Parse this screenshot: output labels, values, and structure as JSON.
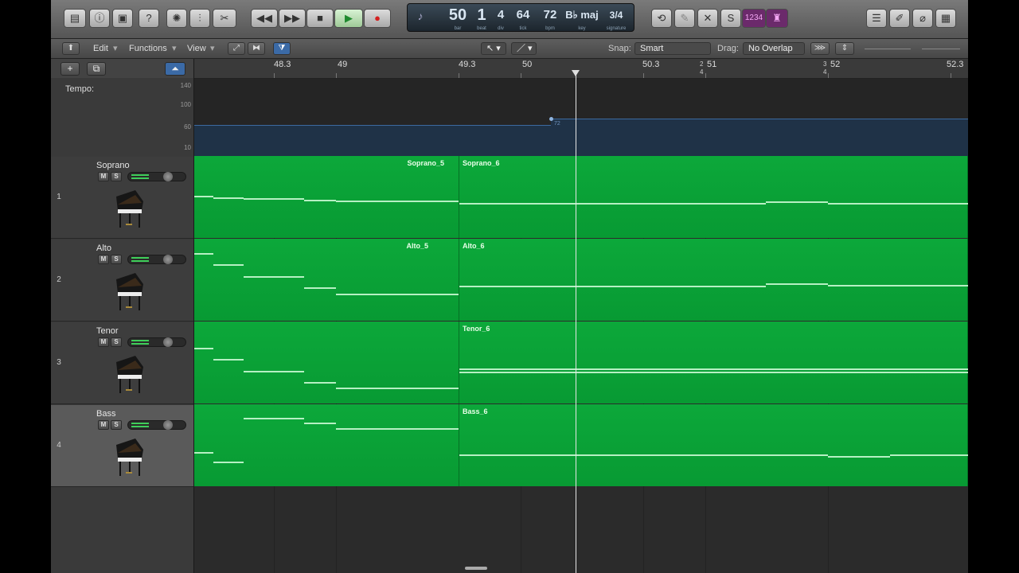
{
  "toolbar": {
    "lcd": {
      "bar": "50",
      "beat": "1",
      "div": "4",
      "tick": "64",
      "bpm": "72",
      "key": "B♭ maj",
      "signature": "3/4",
      "bar_label": "bar",
      "beat_label": "beat",
      "div_label": "div",
      "tick_label": "tick",
      "bpm_label": "bpm",
      "key_label": "key",
      "signature_label": "signature"
    },
    "count_in": "1234"
  },
  "subbar": {
    "edit": "Edit",
    "functions": "Functions",
    "view": "View",
    "snap_label": "Snap:",
    "snap_value": "Smart",
    "drag_label": "Drag:",
    "drag_value": "No Overlap"
  },
  "tempo": {
    "label": "Tempo:",
    "scale": [
      "140",
      "100",
      "60",
      "10"
    ],
    "value_marker": "72"
  },
  "ruler": {
    "bars": [
      "48.3",
      "49",
      "49.3",
      "50",
      "50.3",
      "51",
      "52",
      "52.3"
    ],
    "sig_a": "2",
    "sig_a_den": "4",
    "sig_b": "3",
    "sig_b_den": "4"
  },
  "tracks": [
    {
      "num": "1",
      "name": "Soprano",
      "mute": "M",
      "solo": "S",
      "region_a": "Soprano_5",
      "region_b": "Soprano_6"
    },
    {
      "num": "2",
      "name": "Alto",
      "mute": "M",
      "solo": "S",
      "region_a": "Alto_5",
      "region_b": "Alto_6"
    },
    {
      "num": "3",
      "name": "Tenor",
      "mute": "M",
      "solo": "S",
      "region_a": "",
      "region_b": "Tenor_6"
    },
    {
      "num": "4",
      "name": "Bass",
      "mute": "M",
      "solo": "S",
      "region_a": "",
      "region_b": "Bass_6"
    }
  ],
  "colors": {
    "region": "#0ca83a",
    "note": "#b6f0c3",
    "accent": "#3c6aa0",
    "count_in": "#b02fb0"
  },
  "icons": [
    "library-icon",
    "info-icon",
    "smart-controls-icon",
    "help-icon",
    "toolbar-icon",
    "mixer-icon",
    "editors-icon",
    "rewind-icon",
    "forward-icon",
    "stop-icon",
    "play-icon",
    "record-icon",
    "cycle-icon",
    "autopunch-icon",
    "replace-icon",
    "solo-icon",
    "metronome-icon",
    "list-editors-icon",
    "notepad-icon",
    "loop-browser-icon",
    "browsers-icon"
  ]
}
